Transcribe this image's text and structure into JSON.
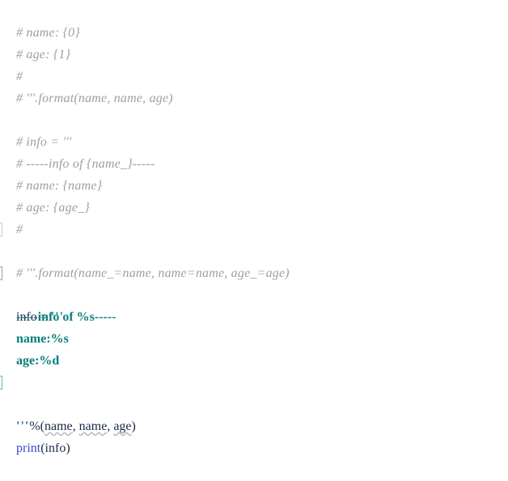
{
  "editor": {
    "background": "#ffffff",
    "comment_color": "#9aa0a8",
    "string_color": "#0b7d7d",
    "identifier_color": "#1b2a4a",
    "builtin_color": "#3b43c8",
    "warning_underline_color": "#b9bcc2",
    "line_height_px": 27,
    "font_size_px": 16
  },
  "code": {
    "lines": [
      {
        "n": 1,
        "kind": "comment",
        "text": "# name: {0}"
      },
      {
        "n": 2,
        "kind": "comment",
        "text": "# age: {1}"
      },
      {
        "n": 3,
        "kind": "comment",
        "text": "#"
      },
      {
        "n": 4,
        "kind": "comment",
        "text": "# '''.format(name, name, age)"
      },
      {
        "n": 5,
        "kind": "blank",
        "text": ""
      },
      {
        "n": 6,
        "kind": "comment",
        "text": "# info = '''"
      },
      {
        "n": 7,
        "kind": "comment",
        "text": "# -----info of {name_}-----"
      },
      {
        "n": 8,
        "kind": "comment",
        "text": "# name: {name}"
      },
      {
        "n": 9,
        "kind": "comment",
        "text": "# age: {age_}"
      },
      {
        "n": 10,
        "kind": "comment",
        "text": "#"
      },
      {
        "n": 11,
        "kind": "comment",
        "text": "# '''.format(name_=name, name=name, age_=age)"
      },
      {
        "n": 12,
        "kind": "blank",
        "text": ""
      },
      {
        "n": 13,
        "kind": "code",
        "text": "info = '''"
      },
      {
        "n": 14,
        "kind": "string",
        "text": "-----info of %s-----"
      },
      {
        "n": 15,
        "kind": "string",
        "text": "name:%s"
      },
      {
        "n": 16,
        "kind": "string",
        "text": "age:%d"
      },
      {
        "n": 17,
        "kind": "blank",
        "text": ""
      },
      {
        "n": 18,
        "kind": "code",
        "text": "'''%(name, name, age)"
      },
      {
        "n": 19,
        "kind": "blank",
        "text": ""
      },
      {
        "n": 20,
        "kind": "code",
        "text": "print(info)"
      }
    ],
    "tokens": {
      "line1_comment": "# name: {0}",
      "line2_comment": "# age: {1}",
      "line3_comment": "#",
      "line4_comment": "# '''.format(name, name, age)",
      "line6_comment": "# info = '''",
      "line7_comment": "# -----info of {name_}-----",
      "line8_comment": "# name: {name}",
      "line9_comment": "# age: {age_}",
      "line10_comment": "#",
      "line11_comment": "# '''.format(name_=name, name=name, age_=age)",
      "line13_var": "info",
      "line13_assign": " = ",
      "line13_quote": "'''",
      "line14_string": "-----info of %s-----",
      "line15_string": "name:%s",
      "line16_string": "age:%d",
      "line18_quote": "'''",
      "line18_percent": "%(",
      "line18_arg1": "name",
      "line18_sep1": ", ",
      "line18_arg2": "name",
      "line18_sep2": ", ",
      "line18_arg3": "age",
      "line18_close": ")",
      "line20_builtin": "print",
      "line20_open": "(",
      "line20_arg": "info",
      "line20_close": ")"
    }
  }
}
